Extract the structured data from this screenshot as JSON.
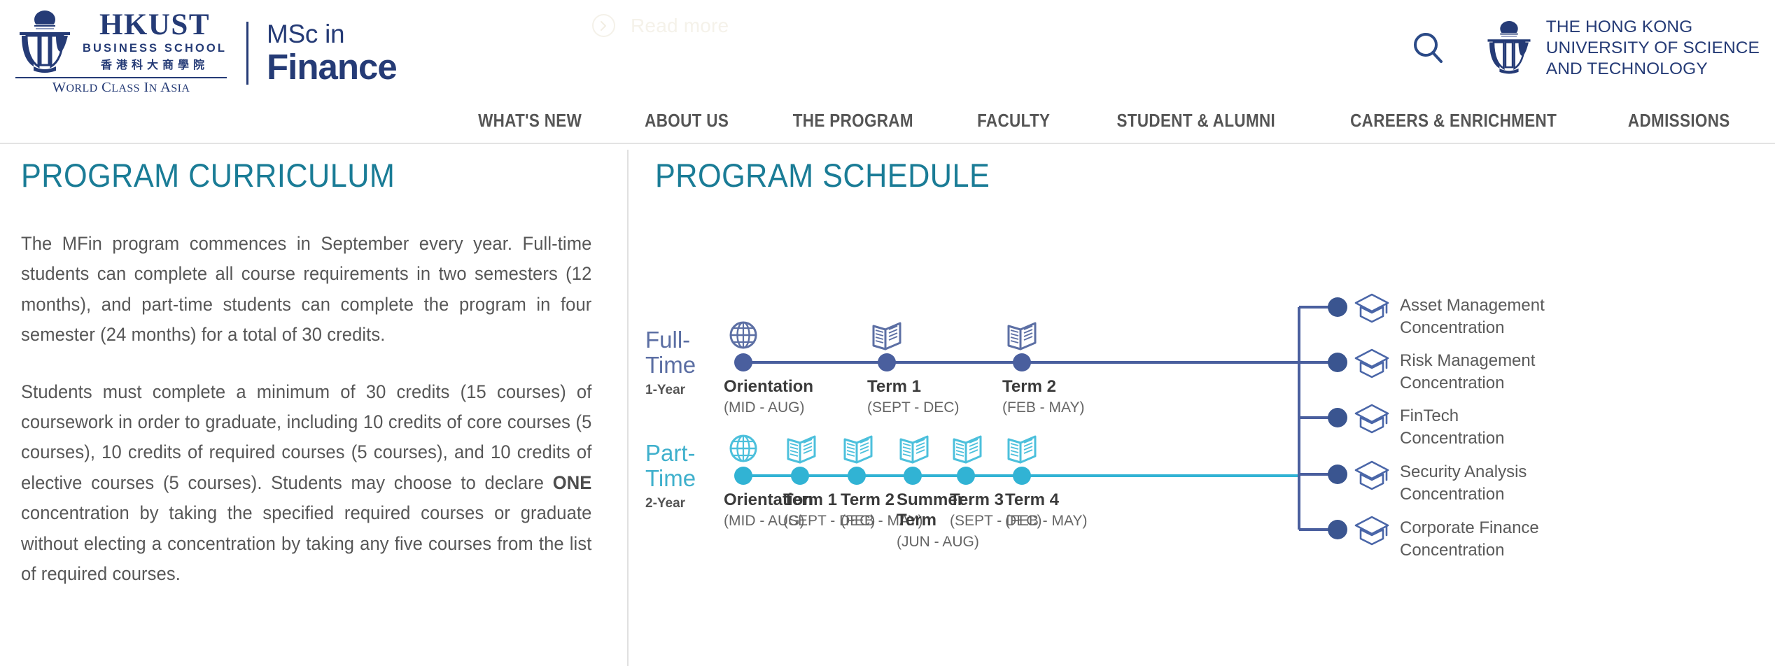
{
  "read_more": {
    "label": "Read more",
    "icon": "chevron-right-circle-icon"
  },
  "header": {
    "business_school": {
      "hkust": "HKUST",
      "school": "BUSINESS SCHOOL",
      "chinese": "香港科大商學院",
      "tagline_1": "W",
      "tagline": "WORLD CLASS IN ASIA"
    },
    "program": {
      "line1": "MSc in",
      "line2": "Finance"
    },
    "search_icon": "search-icon",
    "university": {
      "line1": "THE HONG KONG",
      "line2": "UNIVERSITY OF SCIENCE",
      "line3": "AND TECHNOLOGY"
    }
  },
  "nav": {
    "items": [
      {
        "label": "WHAT'S NEW"
      },
      {
        "label": "ABOUT US"
      },
      {
        "label": "THE PROGRAM"
      },
      {
        "label": "FACULTY"
      },
      {
        "label": "STUDENT & ALUMNI"
      },
      {
        "label": "CAREERS & ENRICHMENT"
      },
      {
        "label": "ADMISSIONS"
      }
    ]
  },
  "curriculum": {
    "title": "PROGRAM CURRICULUM",
    "paragraph_1": "The MFin program commences in September every year. Full-time students can complete all course requirements in two semesters (12 months), and part-time students can complete the program in four semester (24 months) for a total of 30 credits.",
    "paragraph_2_part_a": "Students must complete a minimum of 30 credits (15 courses) of coursework in order to graduate, including 10 credits of core courses (5 courses), 10 credits of required courses (5 courses), and 10 credits of elective courses (5 courses). Students may choose to declare ",
    "paragraph_2_emphasis": "ONE",
    "paragraph_2_part_b": " concentration by taking the specified required courses or graduate without electing a concentration by taking any five courses from the list of required courses."
  },
  "schedule": {
    "title": "PROGRAM SCHEDULE",
    "colors": {
      "full_time": "#4a5f9e",
      "part_time": "#31b3d4",
      "teal_heading": "#1a7c96",
      "caption": "#3b3b3b",
      "trunk": "#4a5f9e"
    },
    "tracks": [
      {
        "id": "full-time",
        "name_line1": "Full-",
        "name_line2": "Time",
        "duration": "1-Year",
        "nodes": [
          {
            "icon": "globe-icon",
            "title": "Orientation",
            "period": "(MID - AUG)"
          },
          {
            "icon": "open-book-icon",
            "title": "Term 1",
            "period": "(SEPT - DEC)"
          },
          {
            "icon": "open-book-icon",
            "title": "Term 2",
            "period": "(FEB - MAY)"
          }
        ]
      },
      {
        "id": "part-time",
        "name_line1": "Part-",
        "name_line2": "Time",
        "duration": "2-Year",
        "nodes": [
          {
            "icon": "globe-icon",
            "title": "Orientation",
            "period": "(MID - AUG)"
          },
          {
            "icon": "open-book-icon",
            "title": "Term 1",
            "period": "(SEPT - DEC)"
          },
          {
            "icon": "open-book-icon",
            "title": "Term 2",
            "period": "(FEB - MAY)"
          },
          {
            "icon": "open-book-icon",
            "title": "Summer Term",
            "title_line1": "Summer",
            "title_line2": "Term",
            "period": "(JUN - AUG)"
          },
          {
            "icon": "open-book-icon",
            "title": "Term 3",
            "period": "(SEPT - DEC)"
          },
          {
            "icon": "open-book-icon",
            "title": "Term 4",
            "period": "(FEB - MAY)"
          }
        ]
      }
    ],
    "concentrations": [
      {
        "icon": "graduation-cap-icon",
        "line1": "Asset Management",
        "line2": "Concentration"
      },
      {
        "icon": "graduation-cap-icon",
        "line1": "Risk Management",
        "line2": "Concentration"
      },
      {
        "icon": "graduation-cap-icon",
        "line1": "FinTech",
        "line2": "Concentration"
      },
      {
        "icon": "graduation-cap-icon",
        "line1": "Security Analysis",
        "line2": "Concentration"
      },
      {
        "icon": "graduation-cap-icon",
        "line1": "Corporate Finance",
        "line2": "Concentration"
      }
    ]
  }
}
